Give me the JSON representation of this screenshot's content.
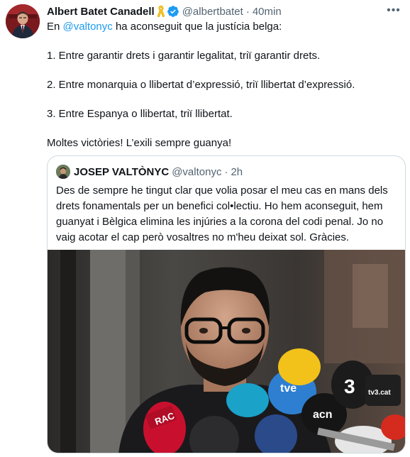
{
  "tweet": {
    "author_name": "Albert Batet Canadell",
    "handle": "@albertbatet",
    "separator": "·",
    "time": "40min",
    "more_label": "•••",
    "text": {
      "intro_prefix": "En ",
      "mention": "@valtonyc",
      "intro_suffix": " ha aconseguit que la justícia belga:",
      "point1": "1. Entre garantir drets i garantir legalitat, triï garantir drets.",
      "point2": "2. Entre monarquia o llibertat d’expressió, triï llibertat d’expressió.",
      "point3": "3. Entre Espanya o llibertat, triï llibertat.",
      "closing": "Moltes victòries! L’exili sempre guanya!"
    },
    "icons": {
      "ribbon": "yellow-ribbon-icon",
      "verified": "verified-badge-icon",
      "more": "more-icon"
    },
    "colors": {
      "accent": "#1d9bf0",
      "secondary_text": "#536471",
      "ribbon": "#f5c518"
    }
  },
  "quote": {
    "author_name": "JOSEP VALTÒNYC",
    "handle": "@valtonyc",
    "separator": "·",
    "time": "2h",
    "lines": [
      "Des de sempre he tingut clar que volia posar el meu cas en mans dels",
      "drets fonamentals per un benefici col•lectiu. Ho hem aconseguit, hem",
      "guanyat i Bèlgica elimina les injúries a la corona del codi penal. Jo no",
      "vaig acotar el cap però vosaltres no m'heu deixat sol. Gràcies."
    ],
    "media": {
      "mic_labels": {
        "rac": "RAC",
        "tve": "tve",
        "acn": "acn",
        "tv3": "tv3.cat",
        "three": "3"
      }
    }
  }
}
